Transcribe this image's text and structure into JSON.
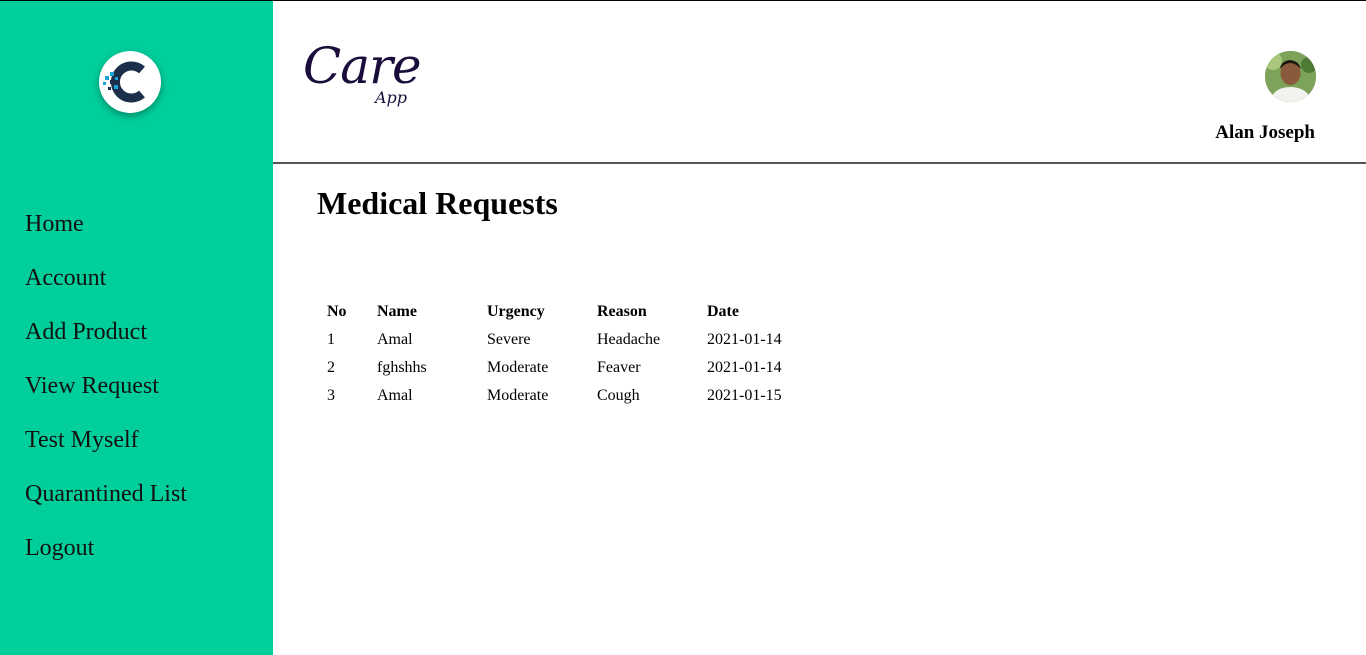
{
  "sidebar": {
    "logo_icon": "c-logo-icon",
    "items": [
      {
        "label": "Home"
      },
      {
        "label": "Account"
      },
      {
        "label": "Add Product"
      },
      {
        "label": "View Request"
      },
      {
        "label": "Test Myself"
      },
      {
        "label": "Quarantined List"
      },
      {
        "label": "Logout"
      }
    ],
    "background": "#00cf9c"
  },
  "header": {
    "brand_main": "Care",
    "brand_sub": "App",
    "brand_color": "#1a0d3b",
    "user_name": "Alan Joseph"
  },
  "main": {
    "title": "Medical Requests",
    "table": {
      "headers": [
        "No",
        "Name",
        "Urgency",
        "Reason",
        "Date"
      ],
      "rows": [
        [
          "1",
          "Amal",
          "Severe",
          "Headache",
          "2021-01-14"
        ],
        [
          "2",
          "fghshhs",
          "Moderate",
          "Feaver",
          "2021-01-14"
        ],
        [
          "3",
          "Amal",
          "Moderate",
          "Cough",
          "2021-01-15"
        ]
      ]
    }
  }
}
